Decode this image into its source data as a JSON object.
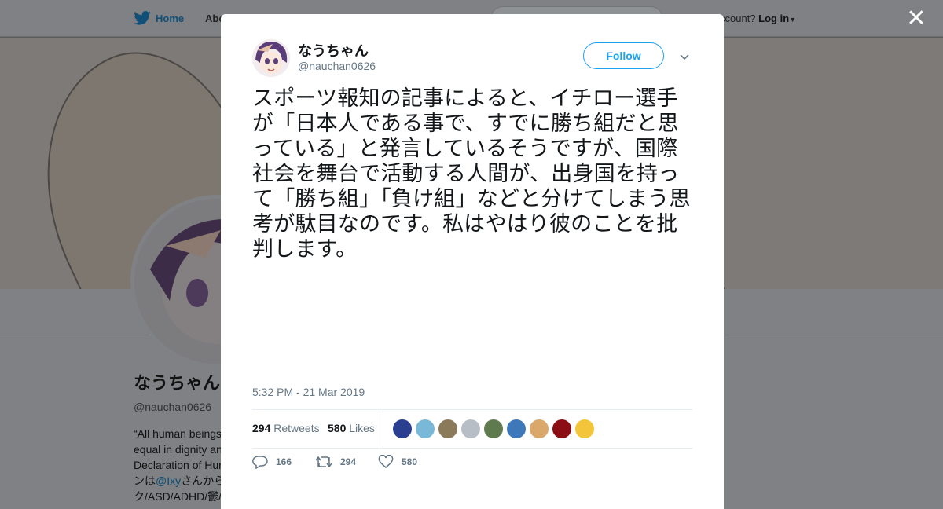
{
  "nav": {
    "home_label": "Home",
    "about_label": "Abo",
    "account_prompt": "ccount?",
    "login_label": "Log in"
  },
  "profile": {
    "name": "なうちゃん",
    "handle": "@nauchan0626",
    "bio_lines": [
      "“All human beings",
      "equal in dignity an",
      "Declaration of Hum"
    ],
    "bio_line4_prefix": "ンは",
    "bio_line4_link": "@Ixy",
    "bio_line4_suffix": "さんから",
    "bio_line5": "ク/ASD/ADHD/鬱/"
  },
  "tweet": {
    "author_name": "なうちゃん",
    "author_handle": "@nauchan0626",
    "follow_label": "Follow",
    "text": "スポーツ報知の記事によると、イチロー選手が「日本人である事で、すでに勝ち組だと思っている」と発言しているそうですが、国際社会を舞台で活動する人間が、出身国を持って「勝ち組」「負け組」などと分けてしまう思考が駄目なのです。私はやはり彼のことを批判します。",
    "timestamp": "5:32 PM - 21 Mar 2019",
    "retweet_count": "294",
    "retweet_label": "Retweets",
    "like_count": "580",
    "like_label": "Likes",
    "reply_action_count": "166",
    "retweet_action_count": "294",
    "like_action_count": "580"
  },
  "likers": [
    {
      "color": "#2a3f8f"
    },
    {
      "color": "#7ab8d8"
    },
    {
      "color": "#8a7a5a"
    },
    {
      "color": "#b8bec6"
    },
    {
      "color": "#5f7a4e"
    },
    {
      "color": "#3f78b8"
    },
    {
      "color": "#d9a86a"
    },
    {
      "color": "#8a0e14"
    },
    {
      "color": "#f2c53a"
    }
  ],
  "colors": {
    "accent": "#1da1f2",
    "text": "#14171a",
    "muted": "#657786"
  }
}
